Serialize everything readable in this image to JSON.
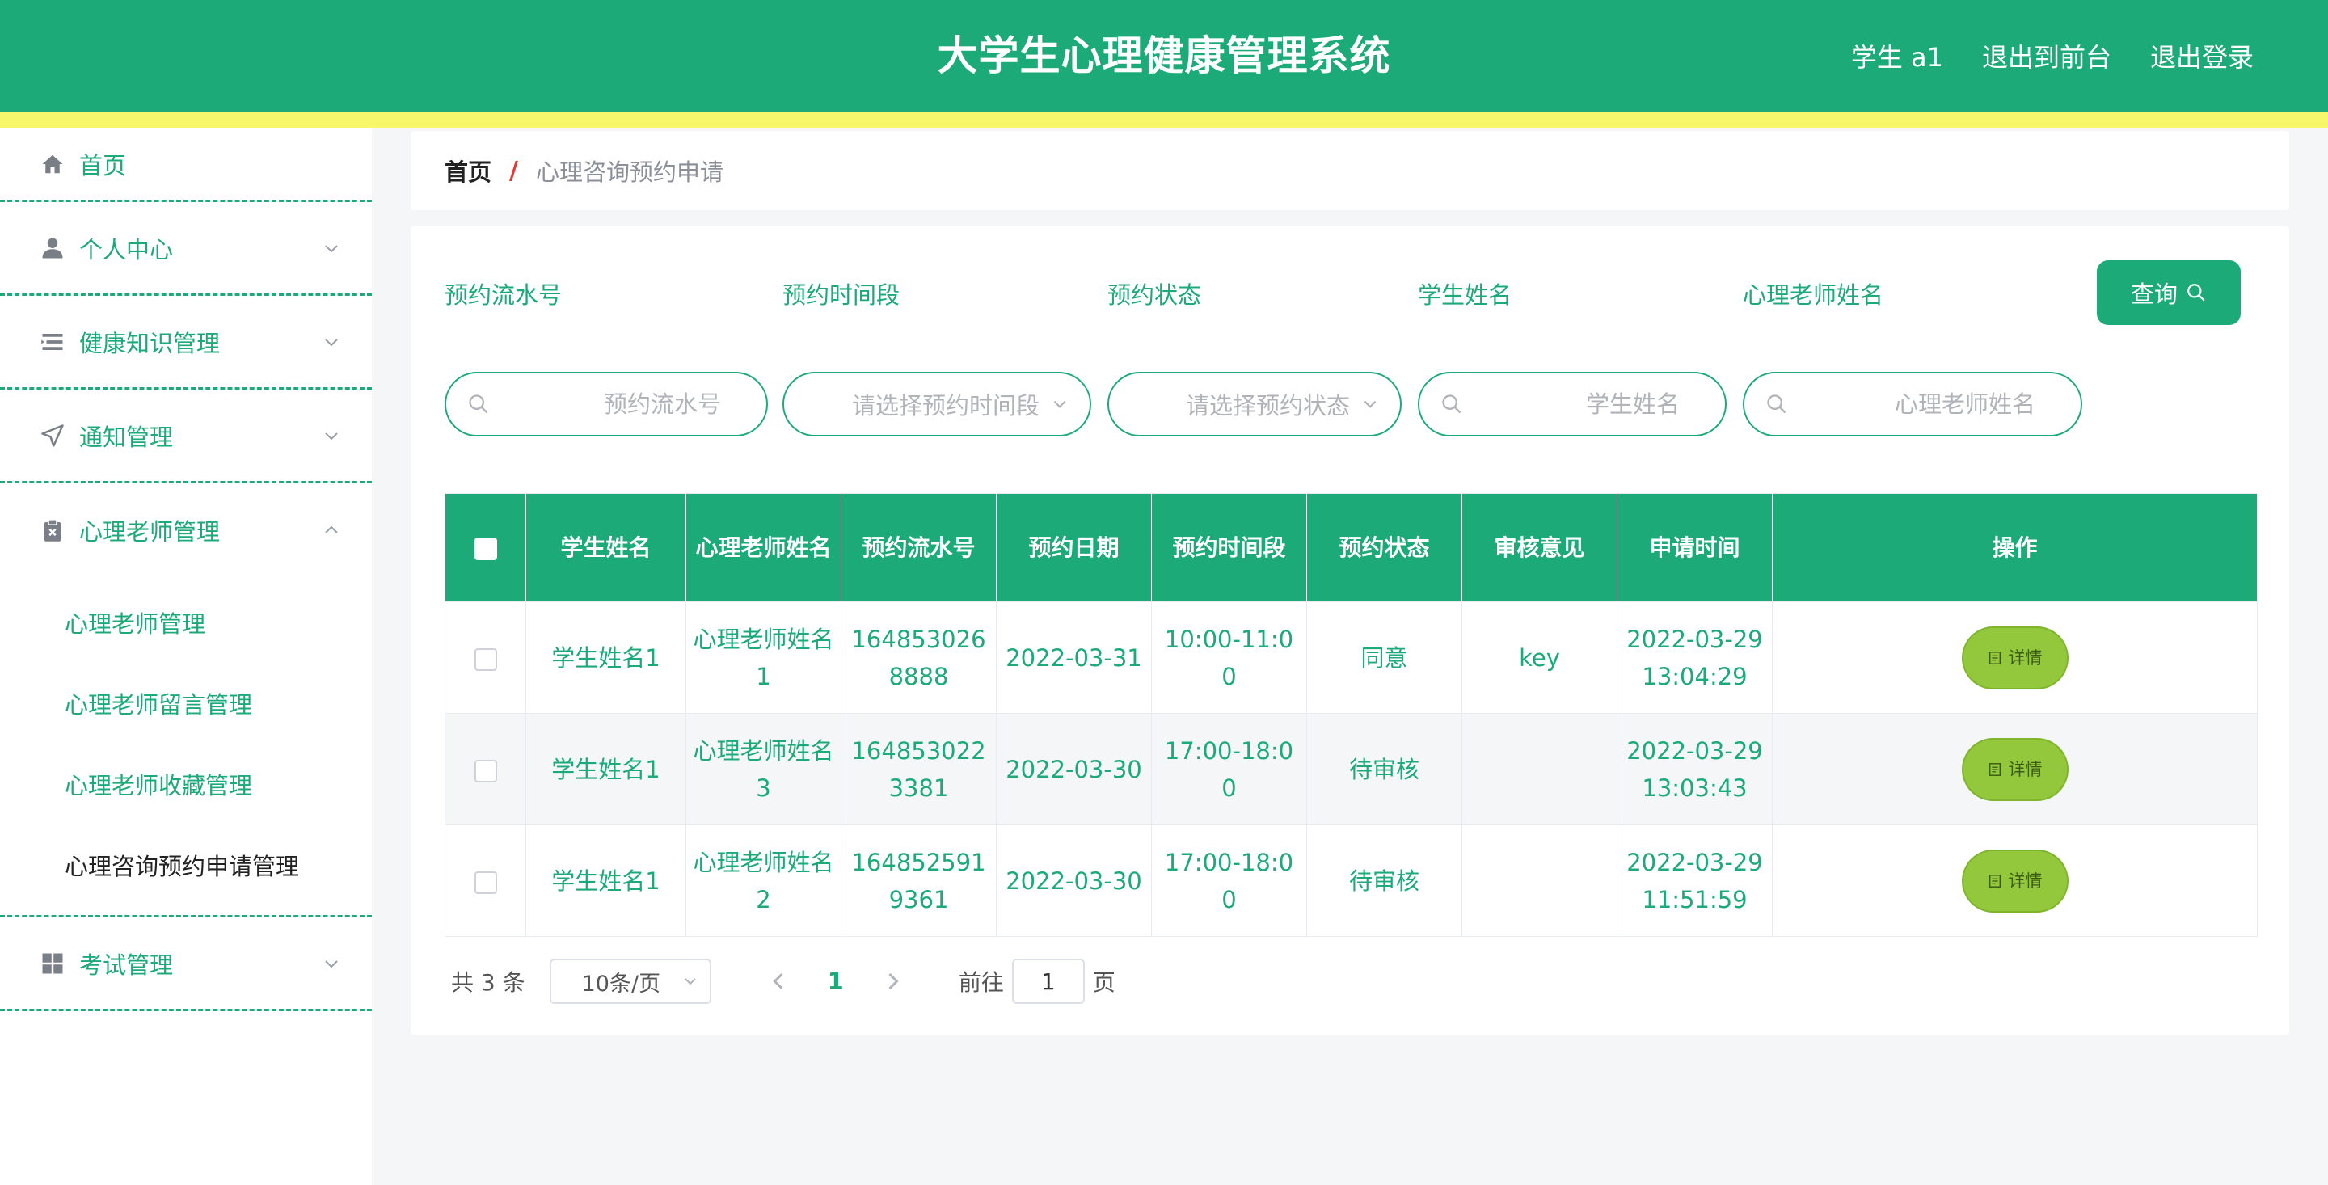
{
  "header": {
    "title": "大学生心理健康管理系统",
    "user": "学生 a1",
    "to_front": "退出到前台",
    "logout": "退出登录"
  },
  "sidebar": {
    "items": [
      {
        "label": "首页",
        "icon": "home-icon"
      },
      {
        "label": "个人中心",
        "icon": "user-icon"
      },
      {
        "label": "健康知识管理",
        "icon": "list-icon"
      },
      {
        "label": "通知管理",
        "icon": "send-icon"
      },
      {
        "label": "心理老师管理",
        "icon": "clipboard-icon"
      },
      {
        "label": "考试管理",
        "icon": "grid-icon"
      }
    ],
    "submenu": [
      {
        "label": "心理老师管理"
      },
      {
        "label": "心理老师留言管理"
      },
      {
        "label": "心理老师收藏管理"
      },
      {
        "label": "心理咨询预约申请管理"
      }
    ]
  },
  "breadcrumb": {
    "home": "首页",
    "separator": "/",
    "current": "心理咨询预约申请"
  },
  "search": {
    "serial": {
      "label": "预约流水号",
      "placeholder": "预约流水号"
    },
    "timeslot": {
      "label": "预约时间段",
      "placeholder": "请选择预约时间段"
    },
    "status": {
      "label": "预约状态",
      "placeholder": "请选择预约状态"
    },
    "student": {
      "label": "学生姓名",
      "placeholder": "学生姓名"
    },
    "teacher": {
      "label": "心理老师姓名",
      "placeholder": "心理老师姓名"
    },
    "query_label": "查询"
  },
  "table": {
    "headers": [
      "学生姓名",
      "心理老师姓名",
      "预约流水号",
      "预约日期",
      "预约时间段",
      "预约状态",
      "审核意见",
      "申请时间",
      "操作"
    ],
    "detail_label": "详情",
    "rows": [
      {
        "student": "学生姓名1",
        "teacher": "心理老师姓名1",
        "serial": "1648530268888",
        "date": "2022-03-31",
        "timeslot": "10:00-11:00",
        "status": "同意",
        "opinion": "key",
        "applied": "2022-03-29 13:04:29"
      },
      {
        "student": "学生姓名1",
        "teacher": "心理老师姓名3",
        "serial": "1648530223381",
        "date": "2022-03-30",
        "timeslot": "17:00-18:00",
        "status": "待审核",
        "opinion": "",
        "applied": "2022-03-29 13:03:43"
      },
      {
        "student": "学生姓名1",
        "teacher": "心理老师姓名2",
        "serial": "1648525919361",
        "date": "2022-03-30",
        "timeslot": "17:00-18:00",
        "status": "待审核",
        "opinion": "",
        "applied": "2022-03-29 11:51:59"
      }
    ]
  },
  "pagination": {
    "total": "共 3 条",
    "page_size": "10条/页",
    "current_page": "1",
    "goto_label": "前往",
    "goto_value": "1",
    "page_unit": "页"
  },
  "colors": {
    "primary": "#1daa79",
    "accent_strip": "#f6f76a",
    "detail_button": "#93c83d"
  }
}
